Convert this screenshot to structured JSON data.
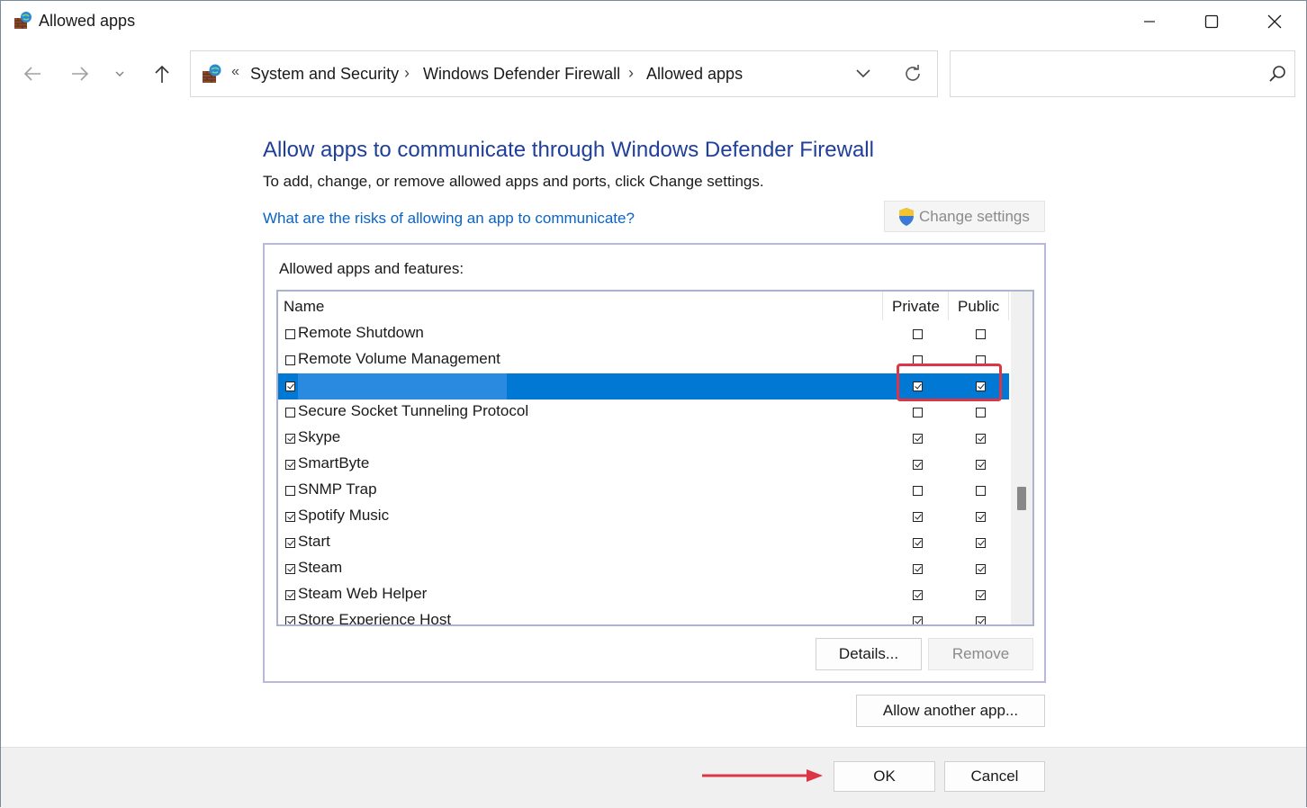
{
  "window": {
    "title": "Allowed apps",
    "controls": {
      "minimize": "minimize-icon",
      "maximize": "maximize-icon",
      "close": "close-icon"
    }
  },
  "address": {
    "overflow": "«",
    "crumbs": [
      "System and Security",
      "Windows Defender Firewall",
      "Allowed apps"
    ],
    "separator": "›"
  },
  "search": {
    "placeholder": "",
    "value": ""
  },
  "main": {
    "heading": "Allow apps to communicate through Windows Defender Firewall",
    "subtext": "To add, change, or remove allowed apps and ports, click Change settings.",
    "risk_link": "What are the risks of allowing an app to communicate?",
    "change_settings": "Change settings",
    "group_label": "Allowed apps and features:",
    "columns": {
      "name": "Name",
      "private": "Private",
      "public": "Public"
    },
    "rows": [
      {
        "name": "Remote Shutdown",
        "enabled": false,
        "private": false,
        "public": false
      },
      {
        "name": "Remote Volume Management",
        "enabled": false,
        "private": false,
        "public": false
      },
      {
        "name": "",
        "enabled": true,
        "private": true,
        "public": true,
        "selected": true
      },
      {
        "name": "Secure Socket Tunneling Protocol",
        "enabled": false,
        "private": false,
        "public": false
      },
      {
        "name": "Skype",
        "enabled": true,
        "private": true,
        "public": true
      },
      {
        "name": "SmartByte",
        "enabled": true,
        "private": true,
        "public": true
      },
      {
        "name": "SNMP Trap",
        "enabled": false,
        "private": false,
        "public": false
      },
      {
        "name": "Spotify Music",
        "enabled": true,
        "private": true,
        "public": true
      },
      {
        "name": "Start",
        "enabled": true,
        "private": true,
        "public": true
      },
      {
        "name": "Steam",
        "enabled": true,
        "private": true,
        "public": true
      },
      {
        "name": "Steam Web Helper",
        "enabled": true,
        "private": true,
        "public": true
      },
      {
        "name": "Store Experience Host",
        "enabled": true,
        "private": true,
        "public": true
      }
    ],
    "details_button": "Details...",
    "remove_button": "Remove",
    "allow_another_button": "Allow another app..."
  },
  "footer": {
    "ok": "OK",
    "cancel": "Cancel"
  },
  "colors": {
    "selection": "#0078d4",
    "highlight": "#dc3545",
    "heading": "#1f3f99",
    "link": "#0a64c8"
  }
}
